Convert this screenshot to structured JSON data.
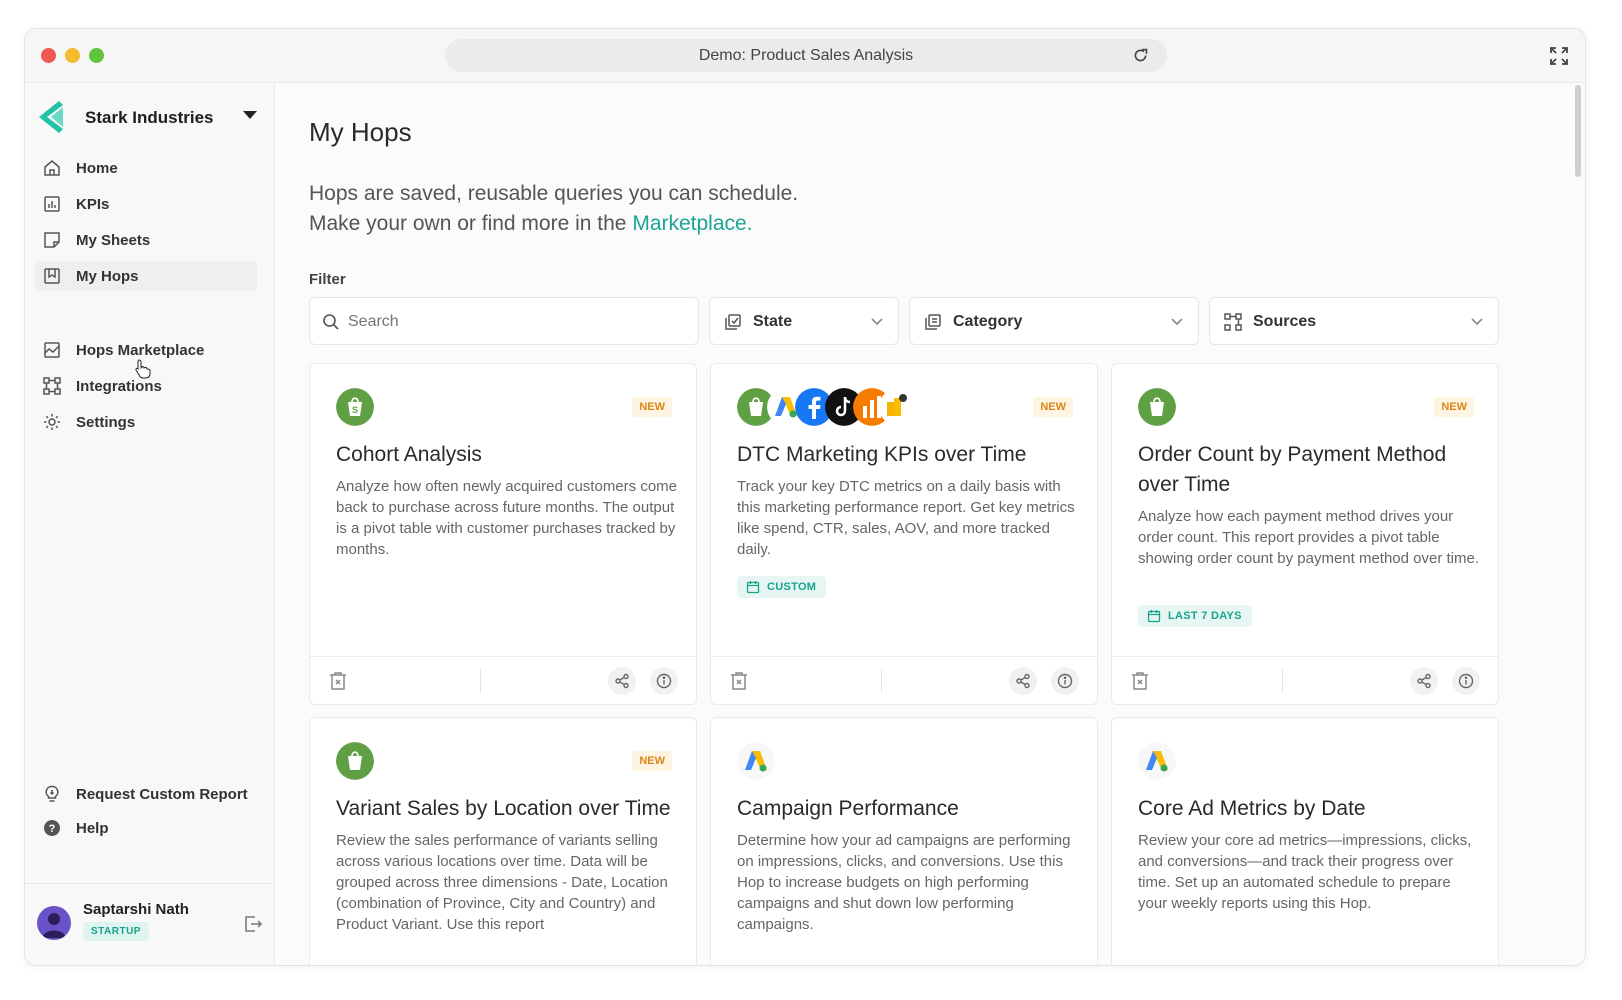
{
  "window": {
    "title": "Demo: Product Sales Analysis"
  },
  "sidebar": {
    "org_name": "Stark Industries",
    "nav": [
      {
        "label": "Home",
        "icon": "home-icon"
      },
      {
        "label": "KPIs",
        "icon": "chart-icon"
      },
      {
        "label": "My Sheets",
        "icon": "sheet-icon"
      },
      {
        "label": "My Hops",
        "icon": "bookmark-icon",
        "active": true
      },
      {
        "label": "Hops Marketplace",
        "icon": "marketplace-icon"
      },
      {
        "label": "Integrations",
        "icon": "integrations-icon"
      },
      {
        "label": "Settings",
        "icon": "gear-icon"
      }
    ],
    "bottom": [
      {
        "label": "Request Custom Report",
        "icon": "lightbulb-icon"
      },
      {
        "label": "Help",
        "icon": "help-icon"
      }
    ],
    "user": {
      "name": "Saptarshi Nath",
      "plan": "STARTUP"
    }
  },
  "main": {
    "title": "My Hops",
    "intro_line1": "Hops are saved, reusable queries you can schedule.",
    "intro_line2_prefix": "Make your own or find more in the ",
    "intro_link": "Marketplace",
    "intro_line2_suffix": ".",
    "filter_label": "Filter",
    "filters": {
      "search_placeholder": "Search",
      "state": "State",
      "category": "Category",
      "sources": "Sources"
    },
    "cards": [
      {
        "title": "Cohort Analysis",
        "badge": "NEW",
        "sources": [
          "shopify"
        ],
        "description": "Analyze how often newly acquired customers come back to purchase across future months. The output is a pivot table with customer purchases tracked by months."
      },
      {
        "title": "DTC Marketing KPIs over Time",
        "badge": "NEW",
        "sources": [
          "shopify",
          "google-ads",
          "facebook",
          "tiktok",
          "analytics",
          "other"
        ],
        "description": "Track your key DTC metrics on a daily basis with this marketing performance report. Get key metrics like spend, CTR, sales, AOV, and more tracked daily.",
        "schedule": "CUSTOM"
      },
      {
        "title": "Order Count by Payment Method over Time",
        "badge": "NEW",
        "sources": [
          "shopify"
        ],
        "description": "Analyze how each payment method drives your order count. This report provides a pivot table showing order count by payment method over time.",
        "schedule": "LAST 7 DAYS"
      },
      {
        "title": "Variant Sales by Location over Time",
        "badge": "NEW",
        "sources": [
          "shopify"
        ],
        "description": "Review the sales performance of variants selling across various locations over time. Data will be grouped across three dimensions - Date, Location (combination of Province, City and Country) and Product Variant. Use this report"
      },
      {
        "title": "Campaign Performance",
        "sources": [
          "google-ads"
        ],
        "description": "Determine how your ad campaigns are performing on impressions, clicks, and conversions. Use this Hop to increase budgets on high performing campaigns and shut down low performing campaigns."
      },
      {
        "title": "Core Ad Metrics by Date",
        "sources": [
          "google-ads"
        ],
        "description": "Review your core ad metrics—impressions, clicks, and conversions—and track their progress over time. Set up an automated schedule to prepare your weekly reports using this Hop."
      }
    ]
  },
  "colors": {
    "accent": "#1ba592",
    "shopify": "#5fa044",
    "new_badge": "#d8881a"
  }
}
